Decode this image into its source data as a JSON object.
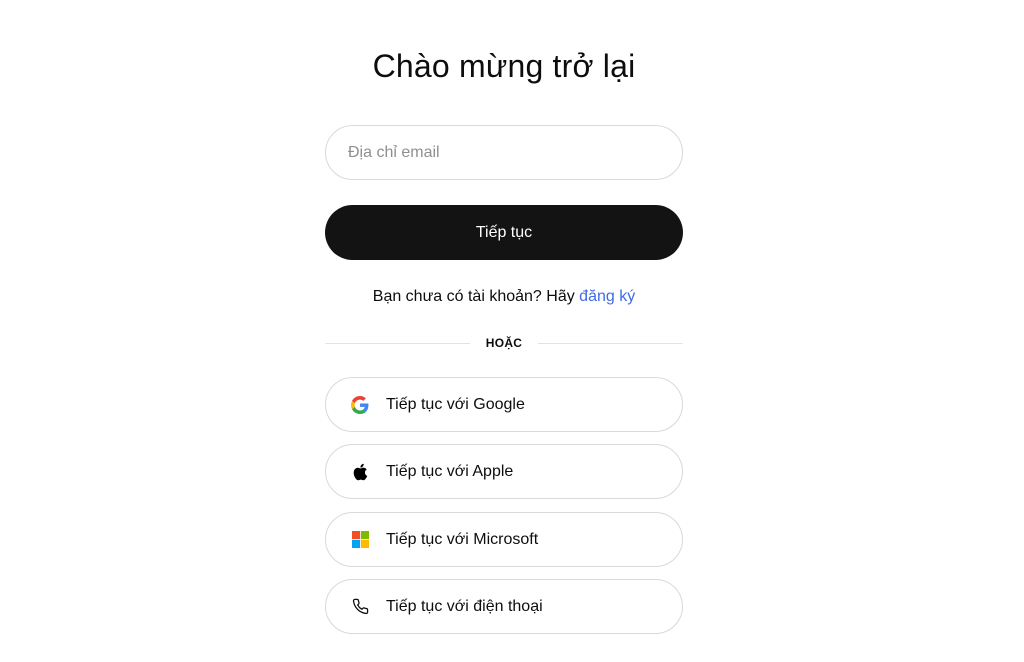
{
  "heading": "Chào mừng trở lại",
  "email": {
    "placeholder": "Địa chỉ email",
    "value": ""
  },
  "continue_label": "Tiếp tục",
  "signup": {
    "prompt": "Bạn chưa có tài khoản? Hãy",
    "link": "đăng ký"
  },
  "divider_label": "HOẶC",
  "social": {
    "google": {
      "label": "Tiếp tục với Google",
      "icon": "google-icon"
    },
    "apple": {
      "label": "Tiếp tục với Apple",
      "icon": "apple-icon"
    },
    "microsoft": {
      "label": "Tiếp tục với Microsoft",
      "icon": "microsoft-icon"
    },
    "phone": {
      "label": "Tiếp tục với điện thoại",
      "icon": "phone-icon"
    }
  },
  "colors": {
    "primary_button": "#131313",
    "link": "#3f6be8",
    "border": "#d9d9d9"
  }
}
